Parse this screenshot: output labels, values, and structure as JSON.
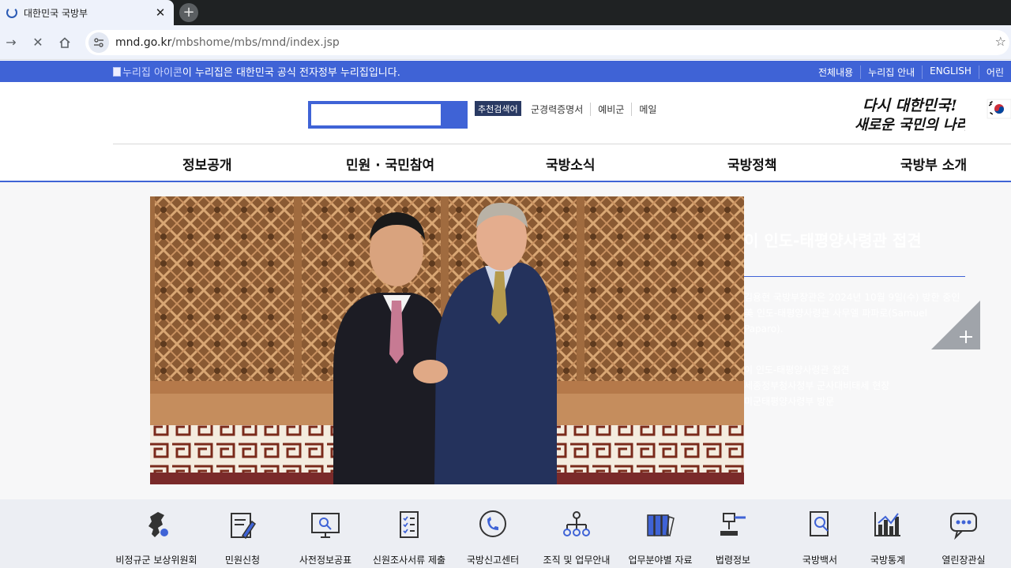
{
  "browser": {
    "tab_title": "대한민국 국방부",
    "tab_close": "✕",
    "new_tab": "+",
    "url_host": "mnd.go.kr",
    "url_path": "/mbshome/mbs/mnd/index.jsp"
  },
  "govbar": {
    "emblem_alt": "누리집 아이콘",
    "notice": "이 누리집은 대한민국 공식 전자정부 누리집입니다.",
    "util_links": [
      "전체내용",
      "누리집 안내",
      "ENGLISH",
      "어린"
    ]
  },
  "header": {
    "search_placeholder": "",
    "recommend_label": "추천검색어",
    "quick_links": [
      "군경력증명서",
      "예비군",
      "메일"
    ],
    "slogan_line1": "다시 대한민국!",
    "slogan_line2": "새로운 국민의 나라"
  },
  "gnb": {
    "items": [
      "정보공개",
      "민원 · 국민참여",
      "국방소식",
      "국방정책",
      "국방부 소개"
    ]
  },
  "visual": {
    "headline": "이 인도-태평양사령관 접견",
    "description": "김용현 국방부장관은 2024년 10월 9일(수) 방한 중인 美 인도-태평양사령관 사무엘 파파로(Samuel Paparo).",
    "list": [
      "이 인도-태평양사령관 접견",
      "세종정부청사정부 군사대비태세 현장",
      "미군태평양사령부 방문"
    ]
  },
  "quick_menu": [
    {
      "label": "비정규군 보상위원회",
      "icon": "korea-map-icon"
    },
    {
      "label": "민원신청",
      "icon": "document-pen-icon"
    },
    {
      "label": "사전정보공표",
      "icon": "monitor-search-icon"
    },
    {
      "label": "신원조사서류 제출",
      "icon": "checklist-icon"
    },
    {
      "label": "국방신고센터",
      "icon": "phone-bubble-icon"
    },
    {
      "label": "조직 및 업무안내",
      "icon": "org-chart-icon"
    },
    {
      "label": "업무분야별 자료",
      "icon": "binders-icon"
    },
    {
      "label": "법령정보",
      "icon": "gavel-icon"
    },
    {
      "label": "국방백서",
      "icon": "book-search-icon"
    },
    {
      "label": "국방통계",
      "icon": "bar-chart-icon"
    },
    {
      "label": "열린장관실",
      "icon": "chat-bubble-icon"
    }
  ],
  "colors": {
    "brand_blue": "#3f63d6",
    "dark_navy": "#2a3a63"
  }
}
